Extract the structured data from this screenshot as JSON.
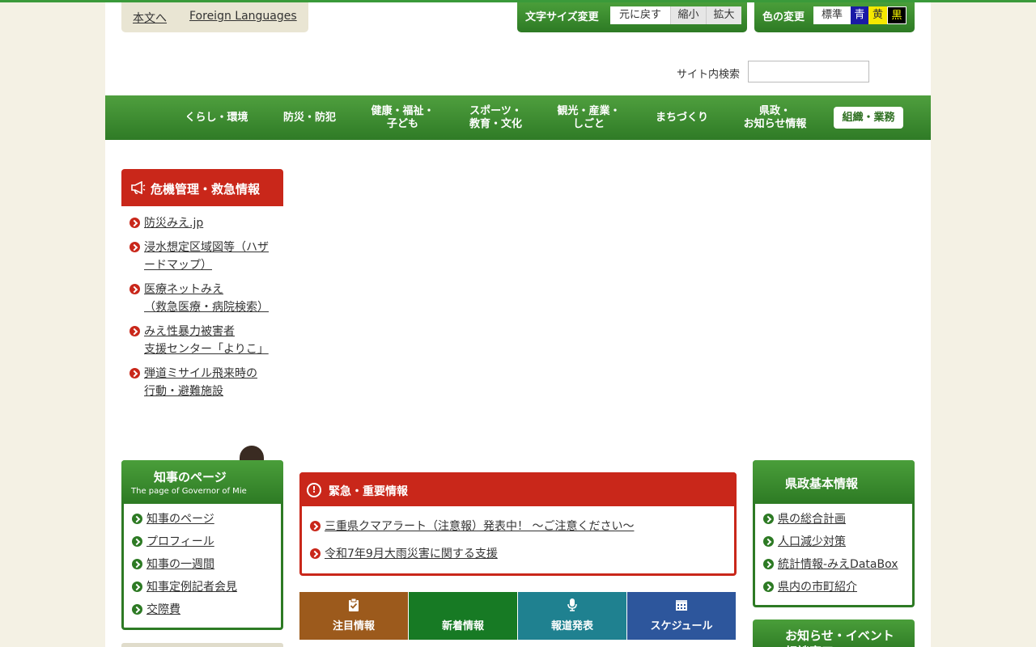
{
  "header": {
    "skip_to_content": "本文へ",
    "foreign_languages": "Foreign Languages",
    "font_size": {
      "title": "文字サイズ変更",
      "reset": "元に戻す",
      "smaller": "縮小",
      "larger": "拡大"
    },
    "color_change": {
      "title": "色の変更",
      "standard": "標準",
      "blue": "青",
      "yellow": "黄",
      "black": "黒"
    },
    "search_label": "サイト内検索"
  },
  "nav": {
    "items": [
      {
        "label": "くらし・環境"
      },
      {
        "label": "防災・防犯"
      },
      {
        "label": "健康・福祉・\n子ども"
      },
      {
        "label": "スポーツ・\n教育・文化"
      },
      {
        "label": "観光・産業・\nしごと"
      },
      {
        "label": "まちづくり"
      },
      {
        "label": "県政・\nお知らせ情報"
      },
      {
        "label": "組織・業務"
      }
    ]
  },
  "crisis": {
    "title": "危機管理・救急情報",
    "links": [
      "防災みえ.jp",
      "浸水想定区域図等（ハザ\nードマップ）",
      "医療ネットみえ\n（救急医療・病院検索）",
      "みえ性暴力被害者\n支援センター「よりこ」",
      "弾道ミサイル飛来時の\n行動・避難施設"
    ]
  },
  "governor": {
    "title": "知事のページ",
    "subtitle": "The page of Governor of Mie",
    "links": [
      "知事のページ",
      "プロフィール",
      "知事の一週間",
      "知事定例記者会見",
      "交際費"
    ]
  },
  "emergency": {
    "title": "緊急・重要情報",
    "links": [
      "三重県クマアラート（注意報）発表中！ ～ご注意ください～",
      "令和7年9月大雨災害に関する支援"
    ]
  },
  "tabs": [
    {
      "label": "注目情報",
      "color": "#9c5a1c"
    },
    {
      "label": "新着情報",
      "color": "#177a24"
    },
    {
      "label": "報道発表",
      "color": "#1f8190"
    },
    {
      "label": "スケジュール",
      "color": "#2d569c"
    }
  ],
  "pref_basic": {
    "title": "県政基本情報",
    "links": [
      "県の総合計画",
      "人口減少対策",
      "統計情報-みえDataBox",
      "県内の市町紹介"
    ]
  },
  "news_events": {
    "title": "お知らせ・イベント\n相談窓口"
  }
}
